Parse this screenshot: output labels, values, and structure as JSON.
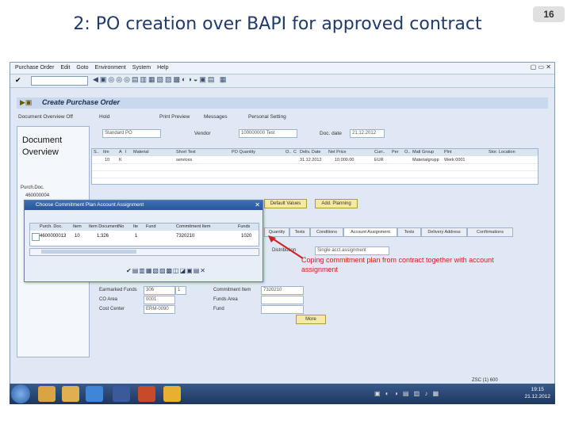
{
  "slide": {
    "title": "2: PO creation over BAPI for approved contract",
    "page_number": "16"
  },
  "sap": {
    "menu": [
      "Purchase Order",
      "Edit",
      "Goto",
      "Environment",
      "System",
      "Help"
    ],
    "screen_title": "Create Purchase Order",
    "app_toolbar": [
      "Document Overview Off",
      "Hold",
      "Print Preview",
      "Messages",
      "Personal Setting"
    ],
    "nav": {
      "label": "Document Overview",
      "purch_doc_label": "Purch.Doc.",
      "doc1": "460000004"
    },
    "header": {
      "doc_type": "Standard PO",
      "vendor_label": "Vendor",
      "vendor_value": "100000000 Test",
      "doc_date_label": "Doc. date",
      "doc_date_value": "21.12.2012"
    },
    "item_grid": {
      "columns": [
        "S..",
        "Itm",
        "A",
        "I",
        "Material",
        "Short Text",
        "PO Quantity",
        "O..",
        "C",
        "Deliv. Date",
        "Net Price",
        "Curr..",
        "Per",
        "O..",
        "Matl Group",
        "Plnt",
        "Stor. Location"
      ],
      "row": {
        "item": "10",
        "acct": "K",
        "short_text": "services",
        "deliv_date": "31.12.2012",
        "net_price": "10,000.00",
        "curr": "EUR",
        "matl_group": "Materialgrupp",
        "plant": "Werk 0001"
      }
    },
    "buttons": {
      "default_values": "Default Values",
      "addl_planning": "Add. Planning",
      "more": "More"
    },
    "tabs": [
      "Quantity",
      "Texts",
      "Conditions",
      "Account Assignment",
      "Texts",
      "Delivery Address",
      "Confirmations"
    ],
    "form": {
      "distribution_label": "Distribution",
      "distribution_value": "Single acct assignment",
      "commitment_item_label": "Commitment Item",
      "commitment_item_value": "7320210",
      "earmarked_label": "Earmarked Funds",
      "earmarked_value": "306",
      "earmarked_item": "1",
      "funds_area_label": "Funds Area",
      "co_area_label": "CO Area",
      "co_area_value": "0001",
      "fund_label": "Fund",
      "cost_center_label": "Cost Center",
      "cost_center_value": "ERM-0090"
    },
    "dialog": {
      "title": "Choose Commitment Plan Account Assignment",
      "columns": [
        "Purch. Doc.",
        "Item",
        "Item DocumentNo",
        "Ite",
        "Fund",
        "Commitment Item",
        "Funds"
      ],
      "row": {
        "purch_doc": "4600000013",
        "item": "10",
        "doc_no": "1:326",
        "ite": "1",
        "fund": "",
        "commitment_item": "7320210",
        "funds": "1020"
      }
    },
    "status_bar": "ZSC (1) 600"
  },
  "annotation": "Coping commitment plan from contract together with account assignment",
  "taskbar": {
    "time": "19:15",
    "date": "21.12.2012"
  },
  "colors": {
    "title": "#1f3a6b",
    "annotation": "#cc2222",
    "sap_bg": "#dfe8f4",
    "dialog_title": "#2a5599"
  }
}
